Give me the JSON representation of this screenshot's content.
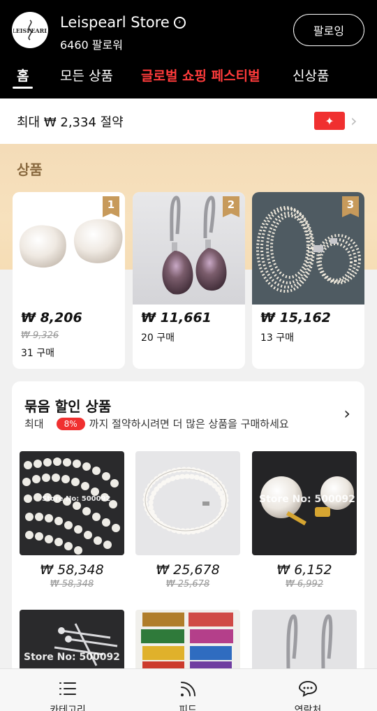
{
  "store": {
    "logo_text": "LEISPEARL",
    "name": "Leispearl Store",
    "followers": "6460 팔로워",
    "follow_label": "팔로잉"
  },
  "tabs": [
    {
      "label": "홈",
      "active": true
    },
    {
      "label": "모든 상품"
    },
    {
      "label": "글로벌 쇼핑 페스티벌",
      "highlight": "#ff3b3b"
    },
    {
      "label": "신상품"
    }
  ],
  "coupon": {
    "text": "최대 ₩ 2,334 절약"
  },
  "products": {
    "title": "상품",
    "items": [
      {
        "rank": "1",
        "price": "₩ 8,206",
        "old_price": "₩ 9,326",
        "sold": "31 구매"
      },
      {
        "rank": "2",
        "price": "₩ 11,661",
        "sold": "20 구매"
      },
      {
        "rank": "3",
        "price": "₩ 15,162",
        "sold": "13 구매"
      }
    ]
  },
  "bundle": {
    "title": "묶음 할인 상품",
    "sub_prefix": "최대",
    "badge": "8%",
    "sub_suffix": "까지 절약하시려면 더 많은 상품을 구매하세요",
    "items": [
      {
        "price": "₩ 58,348",
        "old_price": "₩ 58,348",
        "watermark": "Store No: 500092"
      },
      {
        "price": "₩ 25,678",
        "old_price": "₩ 25,678"
      },
      {
        "price": "₩ 6,152",
        "old_price": "₩ 6,992",
        "watermark": "Store No: 500092"
      },
      {
        "watermark": "Store No: 500092"
      },
      {},
      {}
    ]
  },
  "bottom_nav": [
    {
      "label": "카테고리",
      "icon": "list-icon"
    },
    {
      "label": "피드",
      "icon": "feed-icon"
    },
    {
      "label": "연락처",
      "icon": "chat-icon"
    }
  ]
}
